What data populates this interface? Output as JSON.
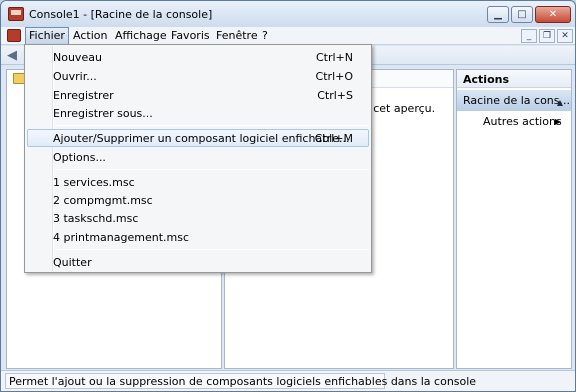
{
  "window": {
    "title": "Console1 - [Racine de la console]"
  },
  "menubar": {
    "items": [
      "Fichier",
      "Action",
      "Affichage",
      "Favoris",
      "Fenêtre",
      "?"
    ]
  },
  "file_menu": {
    "group1": [
      {
        "label": "Nouveau",
        "shortcut": "Ctrl+N"
      },
      {
        "label": "Ouvrir...",
        "shortcut": "Ctrl+O"
      },
      {
        "label": "Enregistrer",
        "shortcut": "Ctrl+S"
      },
      {
        "label": "Enregistrer sous...",
        "shortcut": ""
      }
    ],
    "group2": [
      {
        "label": "Ajouter/Supprimer un composant logiciel enfichable...",
        "shortcut": "Ctrl+M"
      },
      {
        "label": "Options...",
        "shortcut": ""
      }
    ],
    "recent": [
      {
        "label": "1 services.msc"
      },
      {
        "label": "2 compmgmt.msc"
      },
      {
        "label": "3 taskschd.msc"
      },
      {
        "label": "4 printmanagement.msc"
      }
    ],
    "quit": {
      "label": "Quitter"
    }
  },
  "center": {
    "empty_text": "ns cet aperçu."
  },
  "actions": {
    "title": "Actions",
    "group_label": "Racine de la cons...",
    "more_label": "Autres actions"
  },
  "status": {
    "text": "Permet l'ajout ou la suppression de composants logiciels enfichables dans la console"
  },
  "icons": {
    "app": "mmc-console-icon",
    "back": "back-arrow-icon",
    "folder": "folder-icon"
  }
}
